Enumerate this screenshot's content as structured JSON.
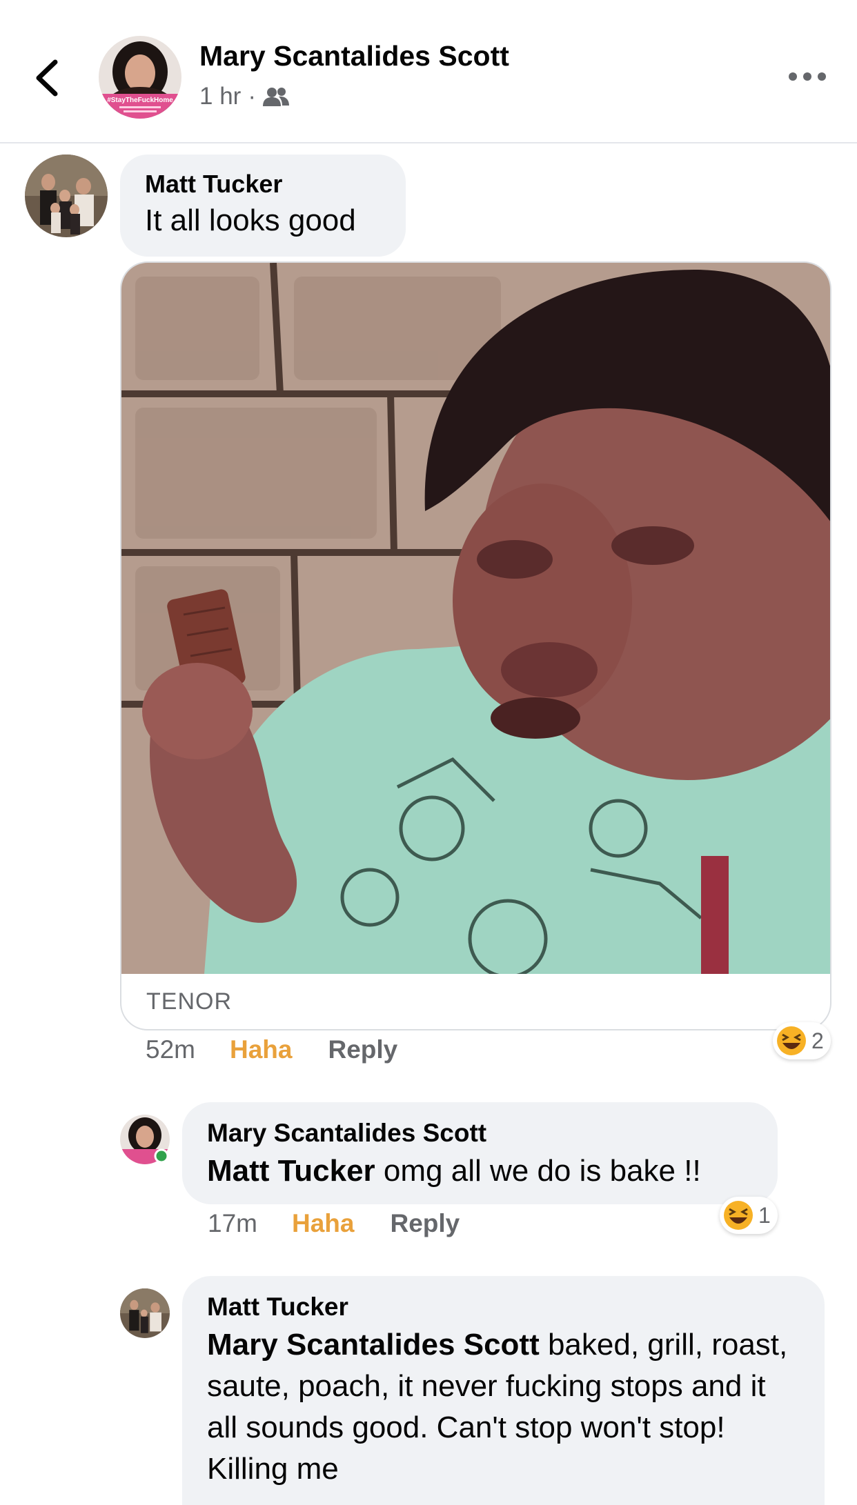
{
  "header": {
    "title": "Mary Scantalides Scott",
    "time": "1 hr",
    "separator": "·",
    "avatar_badge_text": "#StayTheFuckHome",
    "icons": {
      "back": "back-chevron-icon",
      "audience": "friends-icon",
      "more": "more-options-icon"
    }
  },
  "comments": [
    {
      "author": "Matt Tucker",
      "text": "It all looks good",
      "attachment": {
        "type": "gif",
        "source": "TENOR"
      },
      "time": "52m",
      "haha_label": "Haha",
      "reply_label": "Reply",
      "reaction_count": "2"
    },
    {
      "author": "Mary Scantalides Scott",
      "mention": "Matt Tucker",
      "text": " omg all we do is bake !!",
      "time": "17m",
      "haha_label": "Haha",
      "reply_label": "Reply",
      "reaction_count": "1",
      "online": true
    },
    {
      "author": "Matt Tucker",
      "mention": "Mary Scantalides Scott",
      "text": " baked, grill, roast, saute, poach, it never fucking stops and it all sounds good. Can't stop won't stop! Killing me"
    }
  ],
  "colors": {
    "haha": "#e9a13b",
    "bubble": "#f0f2f5",
    "secondary_text": "#65676b",
    "online_dot": "#31a24c",
    "avatar_badge": "#e0508f"
  }
}
